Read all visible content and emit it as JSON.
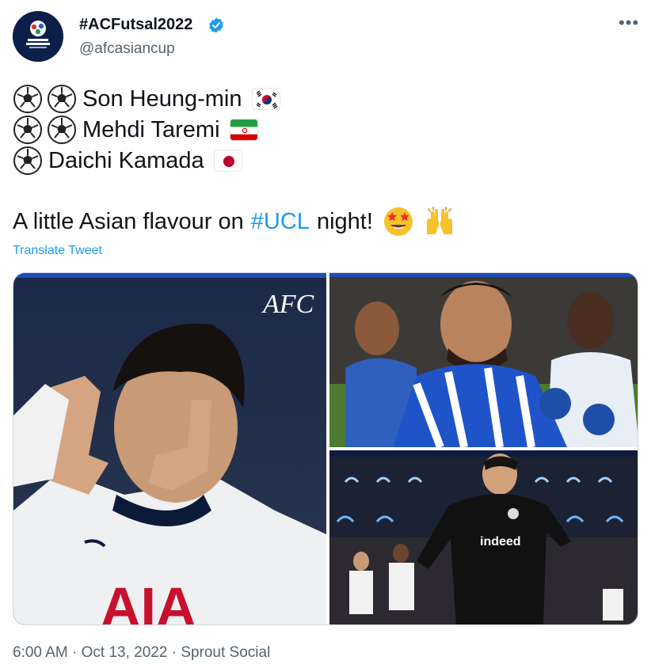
{
  "author": {
    "display_name": "#ACFutsal2022",
    "handle": "@afcasiancup",
    "verified": true
  },
  "tweet": {
    "lines": [
      {
        "balls": 2,
        "name": "Son Heung-min",
        "flag": "south-korea-flag"
      },
      {
        "balls": 2,
        "name": "Mehdi Taremi",
        "flag": "iran-flag"
      },
      {
        "balls": 1,
        "name": "Daichi Kamada",
        "flag": "japan-flag"
      }
    ],
    "sentence_before": "A little Asian flavour on",
    "hashtag": "#UCL",
    "sentence_after": "night!",
    "emojis": [
      "star-struck-emoji",
      "raising-hands-emoji"
    ],
    "translate_label": "Translate Tweet"
  },
  "media": {
    "photos": [
      {
        "name": "photo-son-heung-min",
        "watermark": "AFC"
      },
      {
        "name": "photo-mehdi-taremi"
      },
      {
        "name": "photo-daichi-kamada"
      }
    ]
  },
  "footer": {
    "time": "6:00 AM",
    "sep1": "·",
    "date": "Oct 13, 2022",
    "sep2": "·",
    "source": "Sprout Social"
  },
  "colors": {
    "link": "#1d9bf0",
    "text": "#0f1419",
    "secondary": "#536471"
  }
}
